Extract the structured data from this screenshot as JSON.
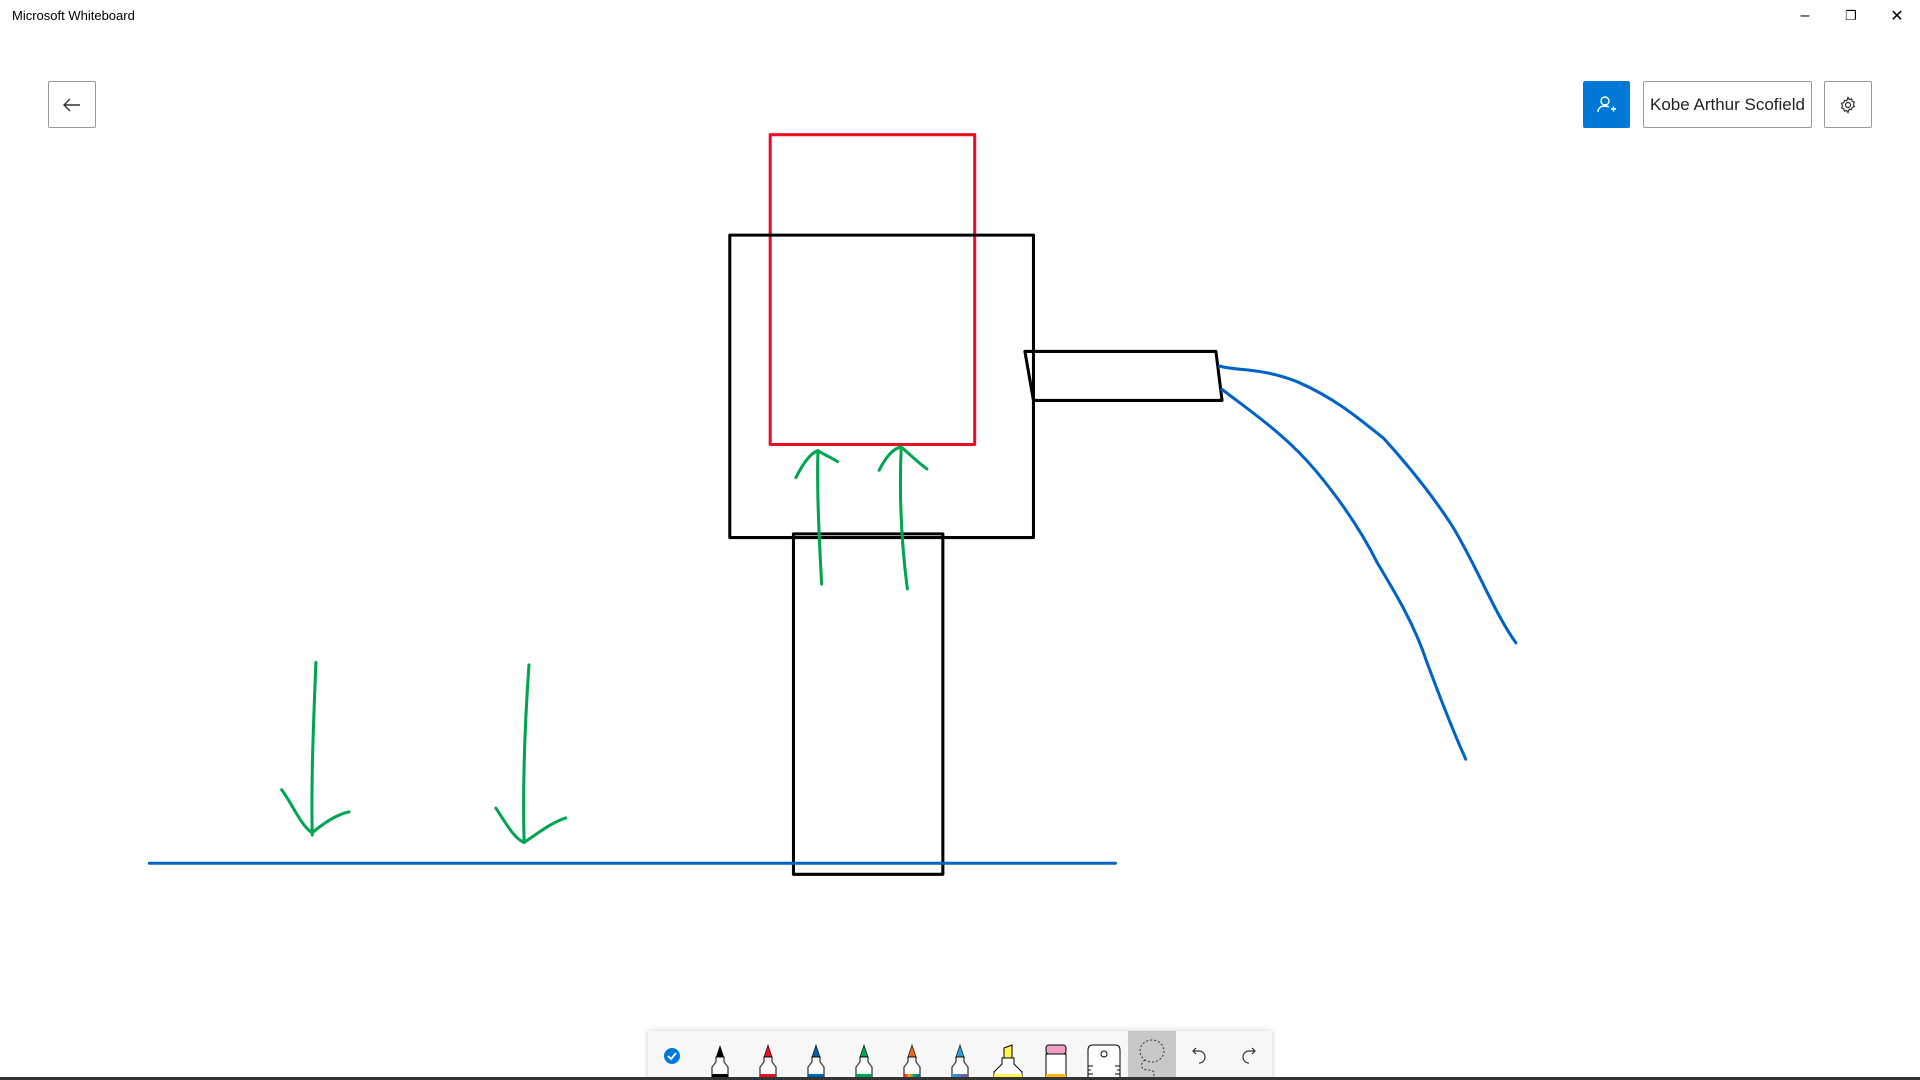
{
  "window": {
    "title": "Microsoft Whiteboard",
    "minimize": "–",
    "restore": "❐",
    "close": "✕"
  },
  "header": {
    "back_icon": "arrow-left-icon",
    "invite_icon": "person-add-icon",
    "user_name": "Kobe Arthur Scofield",
    "settings_icon": "gear-icon"
  },
  "colors": {
    "accent": "#0078d7",
    "red": "#e81123",
    "black": "#000000",
    "green": "#00a550",
    "blue": "#0063c8"
  },
  "toolbar": {
    "tools": [
      {
        "name": "ink-to-shape-toggle",
        "icon": "check-circle-icon"
      },
      {
        "name": "pen-black",
        "color": "#000000"
      },
      {
        "name": "pen-red",
        "color": "#e81123"
      },
      {
        "name": "pen-blue",
        "color": "#0063b1"
      },
      {
        "name": "pen-green",
        "color": "#00a550"
      },
      {
        "name": "pen-rainbow",
        "color": "#e86a1c"
      },
      {
        "name": "pen-galaxy",
        "color": "#2c9fd4"
      },
      {
        "name": "highlighter",
        "color": "#fff44f"
      },
      {
        "name": "eraser",
        "color": "#f0a0c8"
      },
      {
        "name": "ruler"
      },
      {
        "name": "lasso",
        "selected": true
      },
      {
        "name": "undo",
        "icon": "undo-icon"
      },
      {
        "name": "redo",
        "icon": "redo-icon"
      }
    ]
  }
}
